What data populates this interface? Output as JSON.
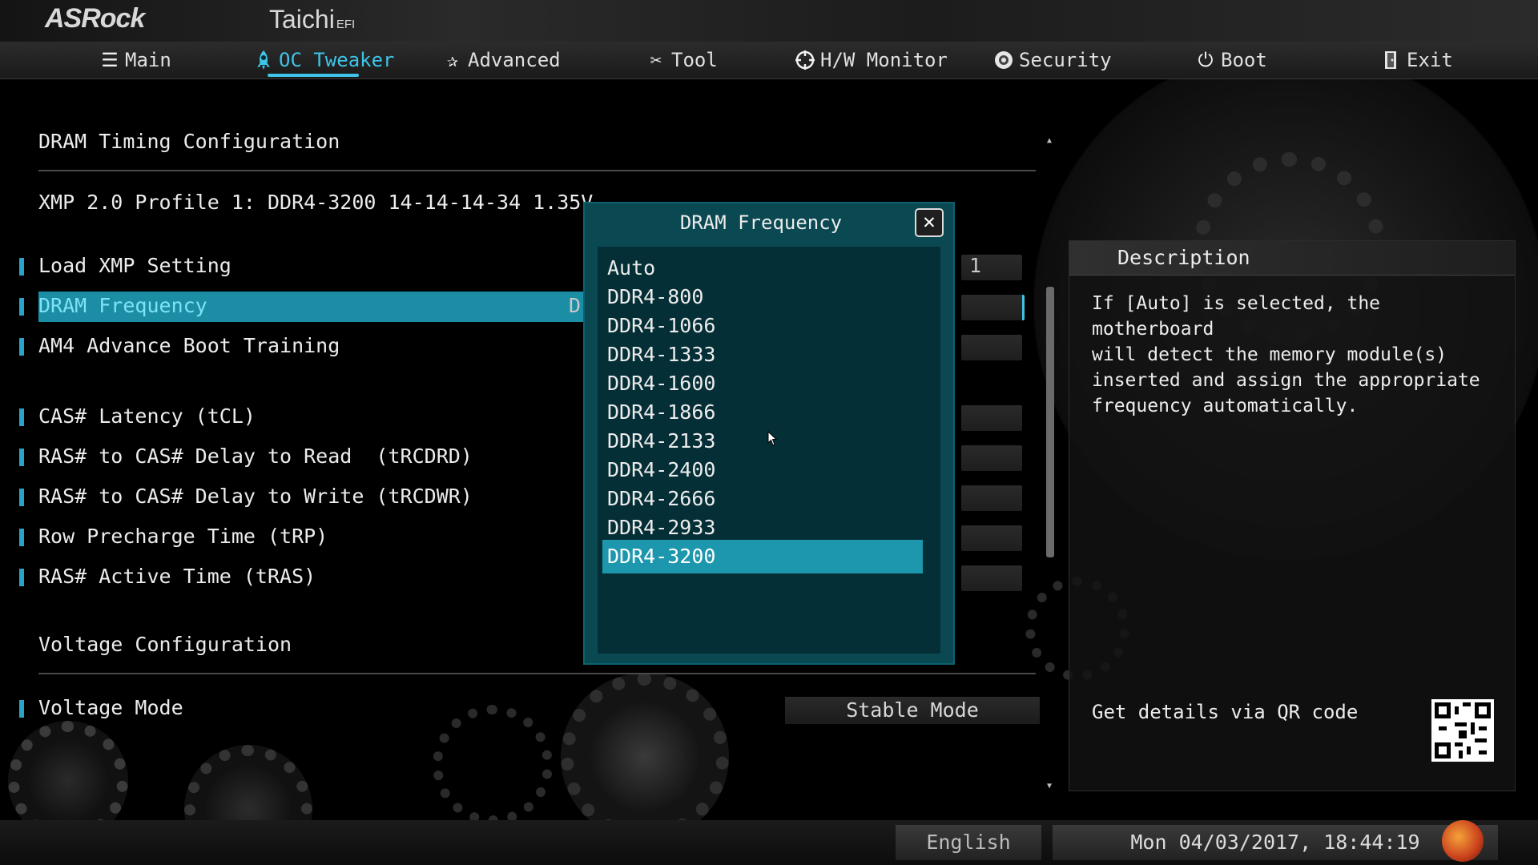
{
  "brand": {
    "logo": "ASRock",
    "model": "Taichi",
    "model_suffix": "EFI"
  },
  "nav": {
    "tabs": [
      {
        "label": "Main",
        "icon": "list-icon"
      },
      {
        "label": "OC Tweaker",
        "icon": "rocket-icon",
        "active": true
      },
      {
        "label": "Advanced",
        "icon": "star-icon"
      },
      {
        "label": "Tool",
        "icon": "tools-icon"
      },
      {
        "label": "H/W Monitor",
        "icon": "crosshair-icon"
      },
      {
        "label": "Security",
        "icon": "shield-icon"
      },
      {
        "label": "Boot",
        "icon": "power-icon"
      },
      {
        "label": "Exit",
        "icon": "door-icon"
      }
    ]
  },
  "main": {
    "section1_title": "DRAM Timing Configuration",
    "xmp_info": "XMP 2.0 Profile 1: DDR4-3200 14-14-14-34 1.35V",
    "items": [
      {
        "label": "Load XMP Setting",
        "value": "1"
      },
      {
        "label": "DRAM Frequency",
        "value": "D"
      },
      {
        "label": "AM4 Advance Boot Training"
      },
      {
        "label": "CAS# Latency (tCL)"
      },
      {
        "label": "RAS# to CAS# Delay to Read  (tRCDRD)"
      },
      {
        "label": "RAS# to CAS# Delay to Write (tRCDWR)"
      },
      {
        "label": "Row Precharge Time (tRP)"
      },
      {
        "label": "RAS# Active Time (tRAS)"
      }
    ],
    "section2_title": "Voltage Configuration",
    "voltage_mode": {
      "label": "Voltage Mode",
      "value": "Stable Mode"
    }
  },
  "popup": {
    "title": "DRAM Frequency",
    "options": [
      "Auto",
      "DDR4-800",
      "DDR4-1066",
      "DDR4-1333",
      "DDR4-1600",
      "DDR4-1866",
      "DDR4-2133",
      "DDR4-2400",
      "DDR4-2666",
      "DDR4-2933",
      "DDR4-3200"
    ],
    "selected": "DDR4-3200"
  },
  "description": {
    "title": "Description",
    "text": "If [Auto] is selected, the motherboard\nwill detect the memory module(s)\ninserted and assign the appropriate\nfrequency automatically.",
    "qr_label": "Get details via QR code"
  },
  "status": {
    "language": "English",
    "datetime": "Mon 04/03/2017, 18:44:19"
  },
  "colors": {
    "accent": "#3ec4e8",
    "selection": "#1b8ea6",
    "popup_bg": "#0a4852"
  }
}
